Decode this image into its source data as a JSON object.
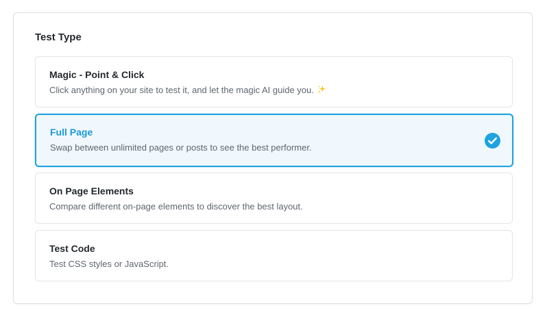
{
  "section": {
    "title": "Test Type"
  },
  "options": [
    {
      "title": "Magic - Point & Click",
      "description": "Click anything on your site to test it, and let the magic AI guide you.",
      "icon": "sparkle-icon",
      "selected": false
    },
    {
      "title": "Full Page",
      "description": "Swap between unlimited pages or posts to see the best performer.",
      "icon": "check-circle-icon",
      "selected": true
    },
    {
      "title": "On Page Elements",
      "description": "Compare different on-page elements to discover the best layout.",
      "selected": false
    },
    {
      "title": "Test Code",
      "description": "Test CSS styles or JavaScript.",
      "selected": false
    }
  ],
  "colors": {
    "accent": "#1fa3de",
    "selected_bg": "#f0f8fd",
    "sparkle": "#f5c518",
    "border": "#e1e4e8"
  }
}
